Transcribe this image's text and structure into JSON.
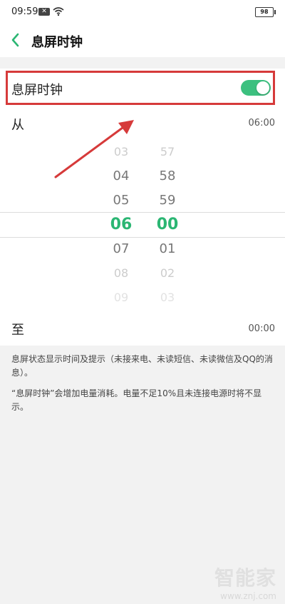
{
  "status_bar": {
    "time": "09:59",
    "notif": "✕",
    "battery": "98"
  },
  "header": {
    "title": "息屏时钟"
  },
  "toggle": {
    "label": "息屏时钟",
    "on": true
  },
  "from": {
    "label": "从",
    "value": "06:00"
  },
  "picker": {
    "hours": [
      "03",
      "04",
      "05",
      "06",
      "07",
      "08",
      "09"
    ],
    "minutes": [
      "57",
      "58",
      "59",
      "00",
      "01",
      "02",
      "03"
    ],
    "selected_hour": "06",
    "selected_minute": "00"
  },
  "to": {
    "label": "至",
    "value": "00:00"
  },
  "notes": [
    "息屏状态显示时间及提示（未接来电、未读短信、未读微信及QQ的消息）。",
    "“息屏时钟”会增加电量消耗。电量不足10%且未连接电源时将不显示。"
  ],
  "watermark": {
    "logo": "智能家",
    "url": "www.znj.com"
  },
  "colors": {
    "accent": "#2bb673",
    "switch": "#3cc07f",
    "annotation": "#d63a3a"
  },
  "icons": {
    "back": "chevron-left-icon",
    "wifi": "wifi-icon",
    "battery": "battery-icon"
  }
}
